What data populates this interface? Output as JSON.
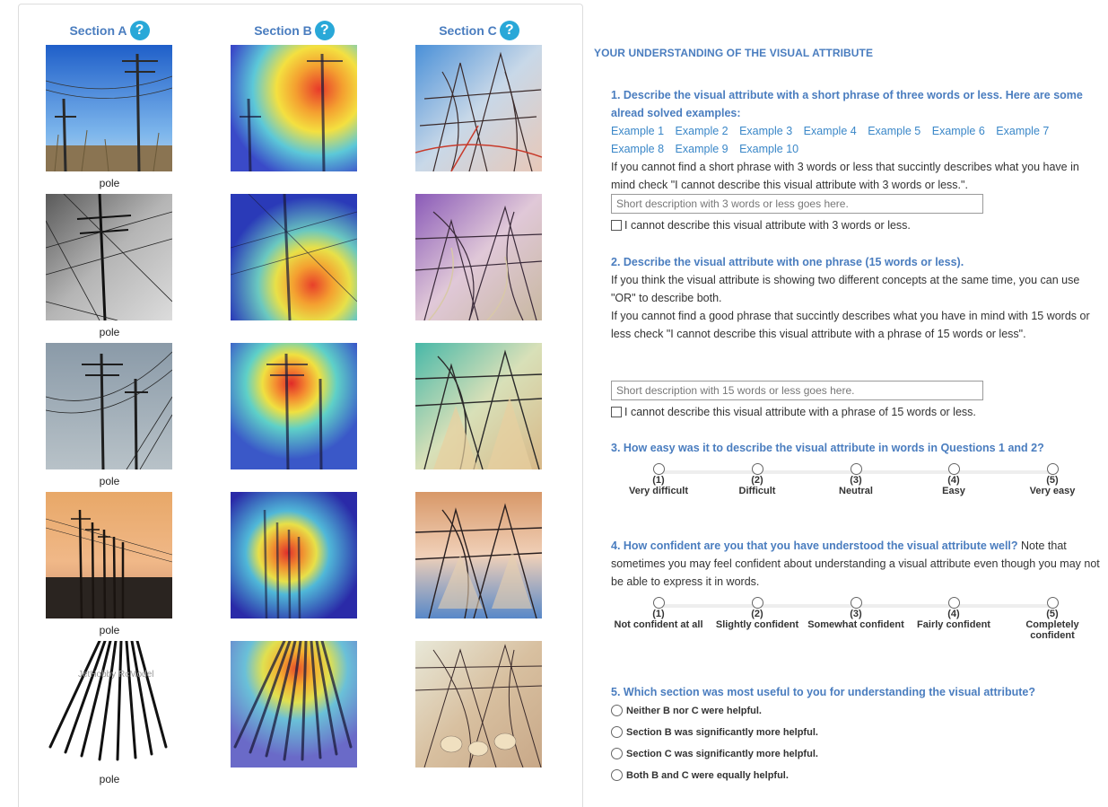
{
  "sections": [
    {
      "label": "Section A",
      "help": "?"
    },
    {
      "label": "Section B",
      "help": "?"
    },
    {
      "label": "Section C",
      "help": "?"
    }
  ],
  "image_labels": [
    "pole",
    "pole",
    "pole",
    "pole",
    "pole"
  ],
  "watermark_text": "JetHobby RcModel",
  "form": {
    "heading": "YOUR UNDERSTANDING OF THE VISUAL ATTRIBUTE",
    "q1": {
      "title": "1. Describe the visual attribute with a short phrase of three words or less. Here are some alread solved examples:",
      "examples": [
        "Example 1",
        "Example 2",
        "Example 3",
        "Example 4",
        "Example 5",
        "Example 6",
        "Example 7",
        "Example 8",
        "Example 9",
        "Example 10"
      ],
      "instruction": "If you cannot find a short phrase with 3 words or less that succintly describes what you have in mind check \"I cannot describe this visual attribute with 3 words or less.\".",
      "placeholder": "Short description with 3 words or less goes here.",
      "checkbox_label": "I cannot describe this visual attribute with 3 words or less."
    },
    "q2": {
      "title": "2. Describe the visual attribute with one phrase (15 words or less).",
      "text1": "If you think the visual attribute is showing two different concepts at the same time, you can use \"OR\" to describe both.",
      "text2": "If you cannot find a good phrase that succintly describes what you have in mind with 15 words or less check \"I cannot describe this visual attribute with a phrase of 15 words or less\".",
      "placeholder": "Short description with 15 words or less goes here.",
      "checkbox_label": "I cannot describe this visual attribute with a phrase of 15 words or less."
    },
    "q3": {
      "title": "3. How easy was it to describe the visual attribute in words in Questions 1 and 2?",
      "options": [
        {
          "num": "(1)",
          "label": "Very difficult"
        },
        {
          "num": "(2)",
          "label": "Difficult"
        },
        {
          "num": "(3)",
          "label": "Neutral"
        },
        {
          "num": "(4)",
          "label": "Easy"
        },
        {
          "num": "(5)",
          "label": "Very easy"
        }
      ]
    },
    "q4": {
      "title": "4. How confident are you that you have understood the visual attribute well?",
      "note": " Note that sometimes you may feel confident about understanding a visual attribute even though you may not be able to express it in words.",
      "options": [
        {
          "num": "(1)",
          "label": "Not confident at all"
        },
        {
          "num": "(2)",
          "label": "Slightly confident"
        },
        {
          "num": "(3)",
          "label": "Somewhat confident"
        },
        {
          "num": "(4)",
          "label": "Fairly confident"
        },
        {
          "num": "(5)",
          "label": "Completely confident"
        }
      ]
    },
    "q5": {
      "title": "5. Which section was most useful to you for understanding the visual attribute?",
      "options": [
        "Neither B nor C were helpful.",
        "Section B was significantly more helpful.",
        "Section C was significantly more helpful.",
        "Both B and C were equally helpful."
      ]
    }
  },
  "colors": {
    "accent": "#4a7dbf",
    "link": "#3a87c8",
    "help": "#29a8d8"
  }
}
